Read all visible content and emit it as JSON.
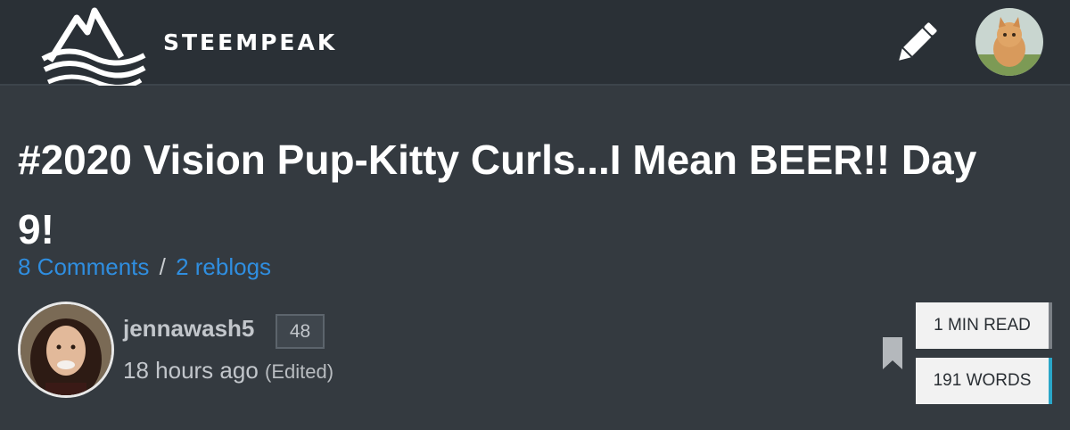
{
  "header": {
    "brand_text": "STEEMPEAK",
    "icons": {
      "logo": "steempeak-logo-icon",
      "write": "pencil-icon",
      "user": "user-avatar"
    }
  },
  "post": {
    "title": "#2020 Vision Pup-Kitty Curls...I Mean BEER!! Day 9!",
    "comments_link": "8 Comments",
    "separator": "/",
    "reblogs_link": "2 reblogs",
    "author": {
      "name": "jennawash5",
      "reputation": "48",
      "time": "18 hours ago",
      "edited": "(Edited)"
    },
    "stats": {
      "read_time": "1 MIN READ",
      "word_count": "191 WORDS"
    }
  },
  "colors": {
    "background": "#343a40",
    "header_bg": "#2a3036",
    "link": "#2f8ee0",
    "words_accent": "#2aa6c8"
  }
}
